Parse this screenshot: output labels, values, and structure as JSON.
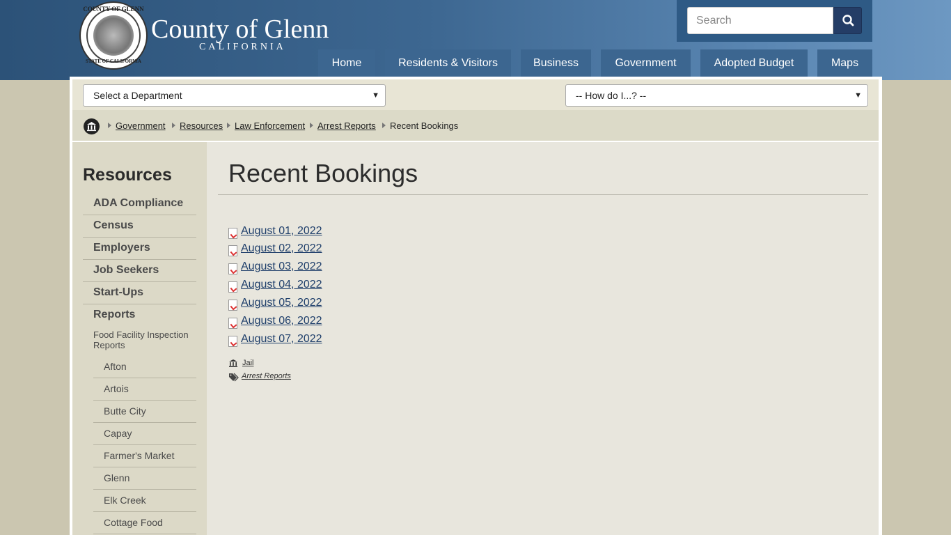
{
  "header": {
    "brand_title": "County of Glenn",
    "brand_subtitle": "CALIFORNIA",
    "seal_top": "COUNTY OF GLENN",
    "seal_bottom": "STATE OF CALIFORNIA",
    "search_placeholder": "Search",
    "search_icon": "magnifier-icon"
  },
  "nav": [
    {
      "label": "Home"
    },
    {
      "label": "Residents & Visitors"
    },
    {
      "label": "Business"
    },
    {
      "label": "Government"
    },
    {
      "label": "Adopted Budget"
    },
    {
      "label": "Maps"
    }
  ],
  "selects": {
    "department": "Select a Department",
    "howdoi": "-- How do I...? --"
  },
  "breadcrumb": [
    {
      "label": "Government"
    },
    {
      "label": "Resources"
    },
    {
      "label": "Law Enforcement"
    },
    {
      "label": "Arrest Reports"
    },
    {
      "label": "Recent Bookings"
    }
  ],
  "sidebar": {
    "title": "Resources",
    "items": [
      {
        "label": "ADA Compliance"
      },
      {
        "label": "Census"
      },
      {
        "label": "Employers"
      },
      {
        "label": "Job Seekers"
      },
      {
        "label": "Start-Ups"
      },
      {
        "label": "Reports"
      }
    ],
    "food_facility": "Food Facility Inspection Reports",
    "subitems": [
      {
        "label": "Afton"
      },
      {
        "label": "Artois"
      },
      {
        "label": "Butte City"
      },
      {
        "label": "Capay"
      },
      {
        "label": "Farmer's Market"
      },
      {
        "label": "Glenn"
      },
      {
        "label": "Elk Creek"
      },
      {
        "label": "Cottage Food"
      }
    ]
  },
  "main": {
    "title": "Recent Bookings",
    "documents": [
      {
        "label": "August 01, 2022"
      },
      {
        "label": "August 02, 2022"
      },
      {
        "label": "August 03, 2022"
      },
      {
        "label": "August 04, 2022"
      },
      {
        "label": "August 05, 2022"
      },
      {
        "label": "August 06, 2022"
      },
      {
        "label": "August 07, 2022"
      }
    ],
    "department_link": "Jail",
    "tag_link": "Arrest Reports"
  },
  "colors": {
    "header_blue": "#3c6690",
    "link_blue": "#1f3f6b",
    "page_bg": "#cbc6b0"
  }
}
